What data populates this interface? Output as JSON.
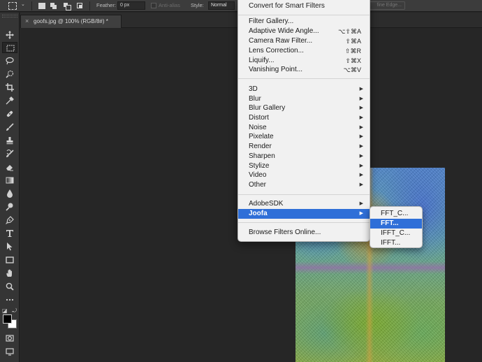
{
  "options_bar": {
    "feather_label": "Feather:",
    "feather_value": "0 px",
    "antialias_label": "Anti-alias",
    "style_label": "Style:",
    "style_value": "Normal",
    "refine_edge_label": "fine Edge..."
  },
  "tools": [
    {
      "name": "move-tool",
      "icon": "move-icon"
    },
    {
      "name": "marquee-tool",
      "icon": "rectangular-marquee-icon",
      "active": true
    },
    {
      "name": "lasso-tool",
      "icon": "lasso-icon"
    },
    {
      "name": "quick-selection-tool",
      "icon": "quick-selection-icon"
    },
    {
      "name": "crop-tool",
      "icon": "crop-icon"
    },
    {
      "name": "eyedropper-tool",
      "icon": "eyedropper-icon"
    },
    {
      "name": "healing-brush-tool",
      "icon": "bandage-icon"
    },
    {
      "name": "brush-tool",
      "icon": "brush-icon"
    },
    {
      "name": "clone-stamp-tool",
      "icon": "stamp-icon"
    },
    {
      "name": "history-brush-tool",
      "icon": "history-brush-icon"
    },
    {
      "name": "eraser-tool",
      "icon": "eraser-icon"
    },
    {
      "name": "gradient-tool",
      "icon": "gradient-icon"
    },
    {
      "name": "blur-tool",
      "icon": "droplet-icon"
    },
    {
      "name": "dodge-tool",
      "icon": "dodge-icon"
    },
    {
      "name": "pen-tool",
      "icon": "pen-icon"
    },
    {
      "name": "type-tool",
      "icon": "type-icon"
    },
    {
      "name": "path-selection-tool",
      "icon": "arrow-icon"
    },
    {
      "name": "rectangle-tool",
      "icon": "rectangle-icon"
    },
    {
      "name": "hand-tool",
      "icon": "hand-icon"
    },
    {
      "name": "zoom-tool",
      "icon": "zoom-icon"
    },
    {
      "name": "edit-toolbar",
      "icon": "ellipsis-icon"
    }
  ],
  "colors": {
    "foreground": "#000000",
    "background": "#ffffff",
    "menu_highlight": "#2f6fd8"
  },
  "document": {
    "tab_title": "goofs.jpg @ 100% (RGB/8#) *"
  },
  "filter_menu": {
    "top_item": "Convert for Smart Filters",
    "group1": [
      {
        "label": "Filter Gallery...",
        "shortcut": ""
      },
      {
        "label": "Adaptive Wide Angle...",
        "shortcut": "⌥⇧⌘A"
      },
      {
        "label": "Camera Raw Filter...",
        "shortcut": "⇧⌘A"
      },
      {
        "label": "Lens Correction...",
        "shortcut": "⇧⌘R"
      },
      {
        "label": "Liquify...",
        "shortcut": "⇧⌘X"
      },
      {
        "label": "Vanishing Point...",
        "shortcut": "⌥⌘V"
      }
    ],
    "group2": [
      {
        "label": "3D"
      },
      {
        "label": "Blur"
      },
      {
        "label": "Blur Gallery"
      },
      {
        "label": "Distort"
      },
      {
        "label": "Noise"
      },
      {
        "label": "Pixelate"
      },
      {
        "label": "Render"
      },
      {
        "label": "Sharpen"
      },
      {
        "label": "Stylize"
      },
      {
        "label": "Video"
      },
      {
        "label": "Other"
      }
    ],
    "group3": [
      {
        "label": "AdobeSDK"
      },
      {
        "label": "Joofa",
        "highlighted": true
      }
    ],
    "browse_online": "Browse Filters Online...",
    "submenu_arrow": "▶"
  },
  "joofa_submenu": [
    {
      "label": "FFT_C..."
    },
    {
      "label": "FFT...",
      "highlighted": true
    },
    {
      "label": "IFFT_C..."
    },
    {
      "label": "IFFT..."
    }
  ]
}
